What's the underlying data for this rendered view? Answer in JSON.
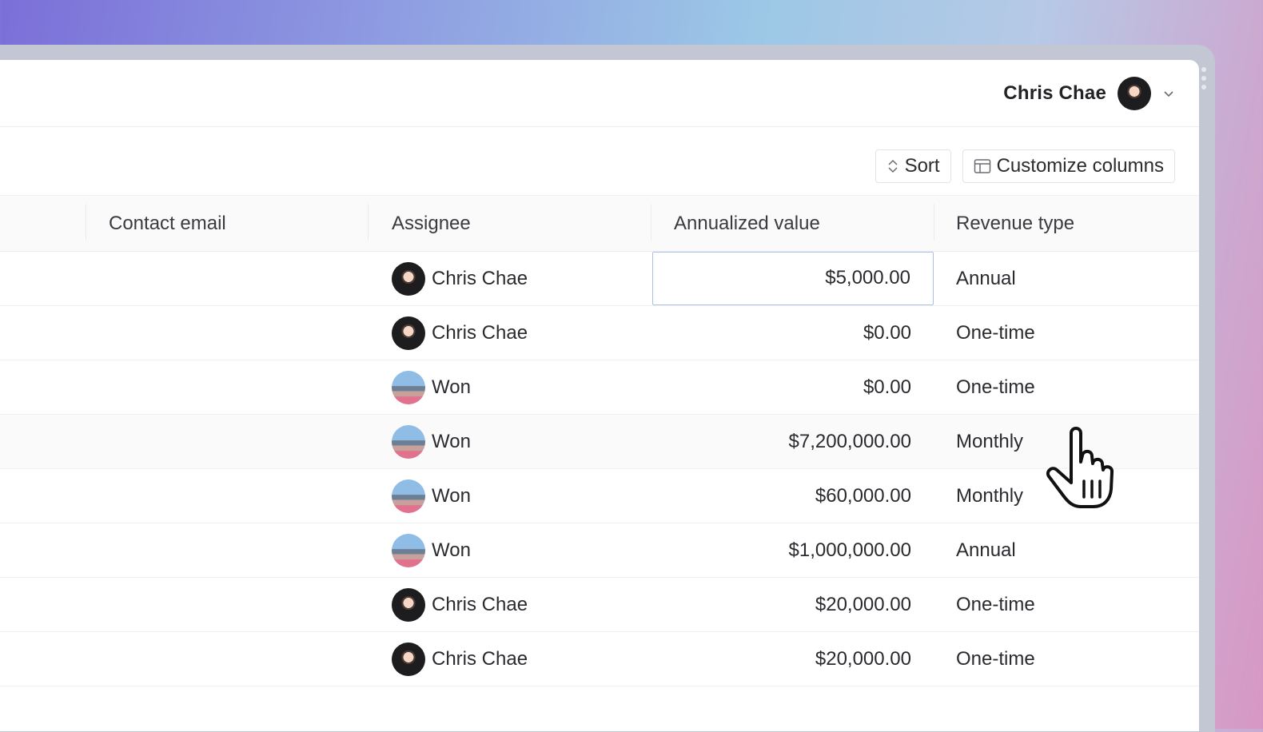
{
  "header": {
    "user_name": "Chris Chae"
  },
  "toolbar": {
    "sort_label": "Sort",
    "customize_label": "Customize columns"
  },
  "table": {
    "columns": {
      "contact_email": "Contact email",
      "assignee": "Assignee",
      "annualized_value": "Annualized value",
      "revenue_type": "Revenue type"
    },
    "rows": [
      {
        "assignee": "Chris Chae",
        "avatar": "chris",
        "value": "$5,000.00",
        "revenue_type": "Annual"
      },
      {
        "assignee": "Chris Chae",
        "avatar": "chris",
        "value": "$0.00",
        "revenue_type": "One-time"
      },
      {
        "assignee": "Won",
        "avatar": "won",
        "value": "$0.00",
        "revenue_type": "One-time"
      },
      {
        "assignee": "Won",
        "avatar": "won",
        "value": "$7,200,000.00",
        "revenue_type": "Monthly"
      },
      {
        "assignee": "Won",
        "avatar": "won",
        "value": "$60,000.00",
        "revenue_type": "Monthly"
      },
      {
        "assignee": "Won",
        "avatar": "won",
        "value": "$1,000,000.00",
        "revenue_type": "Annual"
      },
      {
        "assignee": "Chris Chae",
        "avatar": "chris",
        "value": "$20,000.00",
        "revenue_type": "One-time"
      },
      {
        "assignee": "Chris Chae",
        "avatar": "chris",
        "value": "$20,000.00",
        "revenue_type": "One-time"
      }
    ]
  },
  "icons": {
    "user_chevron": "chevron-down-icon",
    "sort": "sort-icon",
    "customize": "columns-icon",
    "cursor": "hand-pointer-icon"
  },
  "colors": {
    "selected_cell_border": "#a9c2e8",
    "header_bg": "#fafafa"
  }
}
